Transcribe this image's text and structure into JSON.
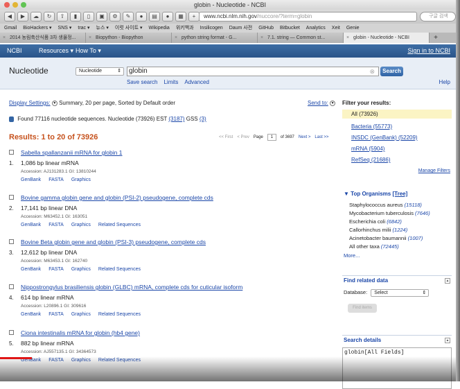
{
  "window": {
    "title": "globin - Nucleotide - NCBI"
  },
  "toolbar": {
    "url_host": "www.ncbi.nlm.nih.gov",
    "url_path": "/nuccore/?term=globin",
    "search_placeholder": "구글 검색"
  },
  "bookmarks": [
    "Gmail",
    "BioHackers ▾",
    "SNS ▾",
    "trac ▾",
    "뉴스 ▾",
    "이럿 사이트 ▾",
    "Wikipedia",
    "위키백과",
    "Insilicogen",
    "Daum 사전",
    "GitHub",
    "Bitbucket",
    "Analytics",
    "Xeit",
    "Genie"
  ],
  "tabs": [
    {
      "label": "2014 농림축산식품 3차 생물정...",
      "active": false
    },
    {
      "label": "Biopython - Biopython",
      "active": false
    },
    {
      "label": "python string format - G...",
      "active": false
    },
    {
      "label": "7.1. string — Common st...",
      "active": false
    },
    {
      "label": "globin - Nucleotide - NCBI",
      "active": true
    }
  ],
  "ncbi": {
    "logo": "NCBI",
    "resources": "Resources ▾",
    "howto": "How To ▾",
    "signin": "Sign in to NCBI"
  },
  "search": {
    "db_title": "Nucleotide",
    "db_select": "Nucleotide",
    "term": "globin",
    "button": "Search",
    "links": [
      "Save search",
      "Limits",
      "Advanced"
    ],
    "help": "Help"
  },
  "results": {
    "display_settings_label": "Display Settings:",
    "display_settings_value": "Summary, 20 per page, Sorted by Default order",
    "send_to": "Send to:",
    "found_text": "Found 77116 nucleotide sequences.",
    "found_nuc_label": "Nucleotide",
    "found_nuc": "(73926)",
    "found_est_label": "EST",
    "found_est": "(3187)",
    "found_gss_label": "GSS",
    "found_gss": "(3)",
    "title": "Results: 1 to 20 of 73926",
    "pager": {
      "first": "<< First",
      "prev": "< Prev",
      "page_label": "Page",
      "page": "1",
      "of": "of 3697",
      "next": "Next >",
      "last": "Last >>"
    },
    "items": [
      {
        "num": "1.",
        "title": "Sabella spallanzanii mRNA for globin 1",
        "len": "1,086 bp linear mRNA",
        "acc": "Accession: AJ131283.1   GI: 13810244",
        "links": [
          "GenBank",
          "FASTA",
          "Graphics"
        ]
      },
      {
        "num": "2.",
        "title": "Bovine gamma globin gene and globin (PSI-2) pseudogene, complete cds",
        "len": "17,141 bp linear DNA",
        "acc": "Accession: M63452.1   GI: 163051",
        "links": [
          "GenBank",
          "FASTA",
          "Graphics",
          "Related Sequences"
        ]
      },
      {
        "num": "3.",
        "title": "Bovine Beta globin gene and globin (PSI-3) pseudogene, complete cds",
        "len": "12,612 bp linear DNA",
        "acc": "Accession: M63453.1   GI: 162740",
        "links": [
          "GenBank",
          "FASTA",
          "Graphics",
          "Related Sequences"
        ]
      },
      {
        "num": "4.",
        "title": "Nippostrongylus brasiliensis globin (GLBC) mRNA, complete cds for cuticular isoform",
        "len": "614 bp linear mRNA",
        "acc": "Accession: L20896.1   GI: 309616",
        "links": [
          "GenBank",
          "FASTA",
          "Graphics",
          "Related Sequences"
        ]
      },
      {
        "num": "5.",
        "title": "Ciona intestinalis mRNA for globin (hb4 gene)",
        "len": "882 bp linear mRNA",
        "acc": "Accession: AJ557135.1   GI: 34364573",
        "links": [
          "GenBank",
          "FASTA",
          "Graphics",
          "Related Sequences"
        ]
      }
    ]
  },
  "sidebar": {
    "filter_title": "Filter your results:",
    "filters": [
      "All (73926)",
      "Bacteria (55773)",
      "INSDC (GenBank) (52209)",
      "mRNA (5904)",
      "RefSeq (21686)"
    ],
    "manage": "Manage Filters",
    "top_org_title": "Top Organisms",
    "tree": "[Tree]",
    "organisms": [
      {
        "name": "Staphylococcus aureus",
        "count": "(15118)"
      },
      {
        "name": "Mycobacterium tuberculosis",
        "count": "(7646)"
      },
      {
        "name": "Escherichia coli",
        "count": "(6842)"
      },
      {
        "name": "Callorhinchus milii",
        "count": "(1224)"
      },
      {
        "name": "Acinetobacter baumannii",
        "count": "(1007)"
      },
      {
        "name": "All other taxa",
        "count": "(72445)"
      }
    ],
    "more": "More...",
    "find_related": "Find related data",
    "database_label": "Database:",
    "database_value": "Select",
    "find_button": "Find items",
    "search_details": "Search details",
    "details_text": "globin[All Fields]"
  }
}
